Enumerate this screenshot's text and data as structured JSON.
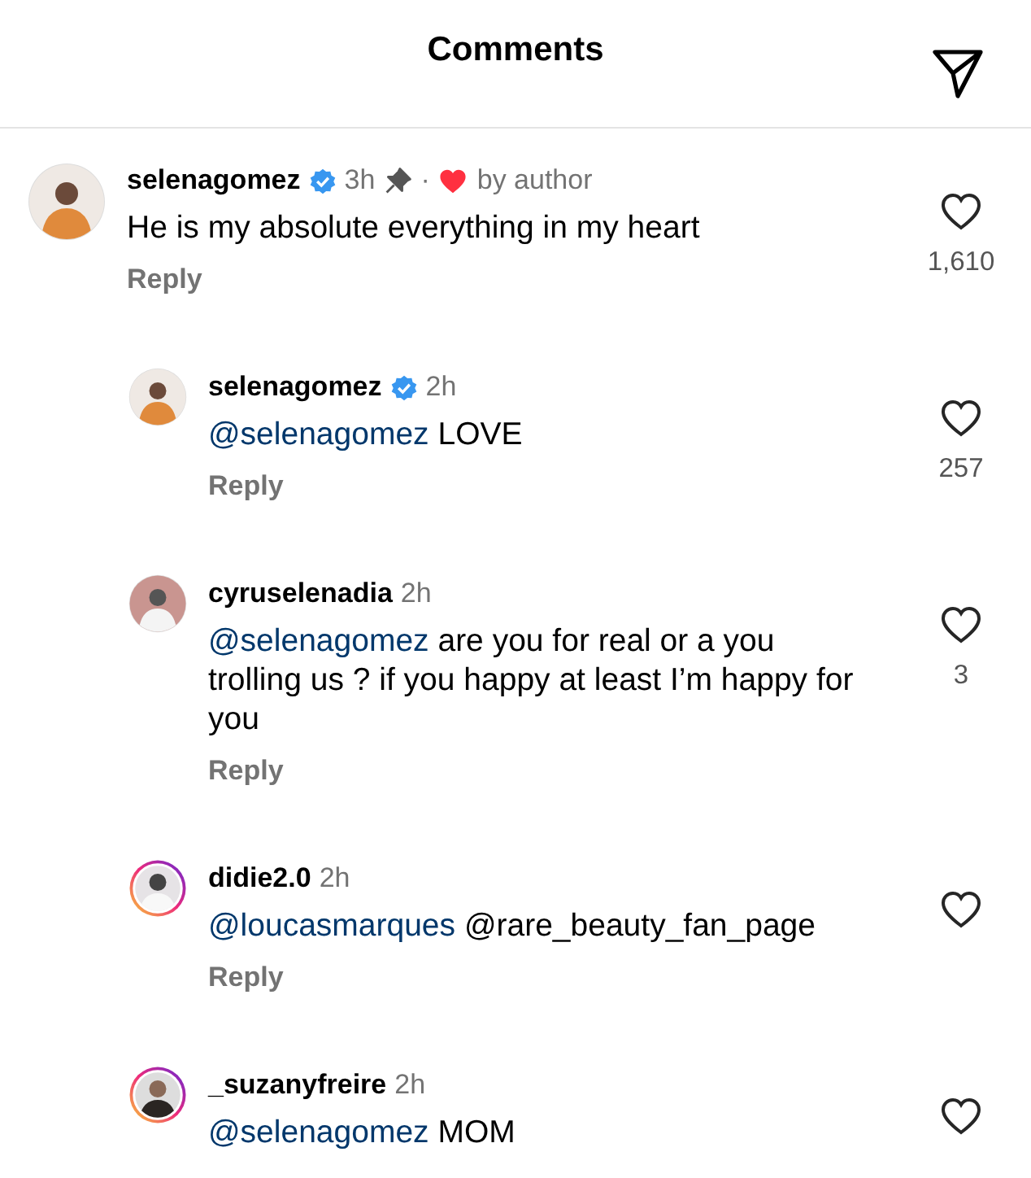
{
  "header": {
    "title": "Comments"
  },
  "comments": [
    {
      "username": "selenagomez",
      "verified": true,
      "time": "3h",
      "pinned": true,
      "separator": "·",
      "liked_by_author": true,
      "author_label": "by author",
      "text": "He is my absolute everything in my heart",
      "reply": "Reply",
      "likes": "1,610",
      "liked": false,
      "story_ring": false,
      "children": [
        {
          "username": "selenagomez",
          "verified": true,
          "time": "2h",
          "pinned": false,
          "liked_by_author": false,
          "mention": "@selenagomez",
          "text": "LOVE",
          "reply": "Reply",
          "likes": "257",
          "liked": false,
          "story_ring": false
        },
        {
          "username": "cyruselenadia",
          "verified": false,
          "time": "2h",
          "pinned": false,
          "liked_by_author": false,
          "mention": "@selenagomez",
          "text": "are you for real or a you trolling us ? if you happy at least I’m happy for you",
          "reply": "Reply",
          "likes": "3",
          "liked": false,
          "story_ring": false
        },
        {
          "username": "didie2.0",
          "verified": false,
          "time": "2h",
          "pinned": false,
          "liked_by_author": false,
          "mention": "@loucasmarques",
          "text": "@rare_beauty_fan_page",
          "reply": "Reply",
          "liked": false,
          "story_ring": true
        },
        {
          "username": "_suzanyfreire",
          "verified": false,
          "time": "2h",
          "pinned": false,
          "liked_by_author": false,
          "mention": "@selenagomez",
          "text": "MOM",
          "liked": false,
          "story_ring": true
        }
      ]
    }
  ]
}
